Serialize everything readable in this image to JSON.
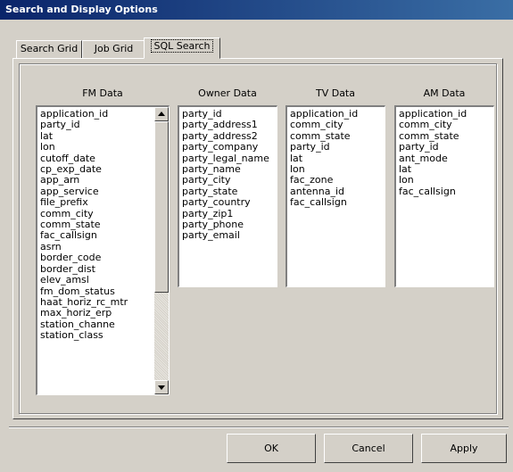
{
  "window": {
    "title": "Search and Display Options"
  },
  "tabs": [
    {
      "label": "Search Grid"
    },
    {
      "label": "Job Grid"
    },
    {
      "label": "SQL Search"
    }
  ],
  "columns": {
    "fm": {
      "title": "FM Data",
      "items": [
        "application_id",
        "party_id",
        "lat",
        "lon",
        "cutoff_date",
        "cp_exp_date",
        "app_arn",
        "app_service",
        "file_prefix",
        "comm_city",
        "comm_state",
        "fac_callsign",
        "asrn",
        "border_code",
        "border_dist",
        "elev_amsl",
        "fm_dom_status",
        "haat_horiz_rc_mtr",
        "max_horiz_erp",
        "station_channe",
        "station_class"
      ]
    },
    "owner": {
      "title": "Owner Data",
      "items": [
        "party_id",
        "party_address1",
        "party_address2",
        "party_company",
        "party_legal_name",
        "party_name",
        "party_city",
        "party_state",
        "party_country",
        "party_zip1",
        "party_phone",
        "party_email"
      ]
    },
    "tv": {
      "title": "TV Data",
      "items": [
        "application_id",
        "comm_city",
        "comm_state",
        "party_id",
        "lat",
        "lon",
        "fac_zone",
        "antenna_id",
        "fac_callsign"
      ]
    },
    "am": {
      "title": "AM Data",
      "items": [
        "application_id",
        "comm_city",
        "comm_state",
        "party_id",
        "ant_mode",
        "lat",
        "lon",
        "fac_callsign"
      ]
    }
  },
  "buttons": {
    "ok": "OK",
    "cancel": "Cancel",
    "apply": "Apply"
  }
}
